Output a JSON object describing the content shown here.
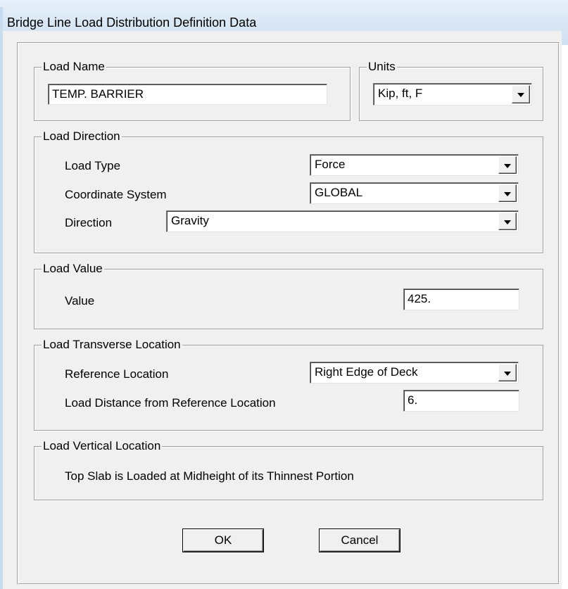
{
  "window": {
    "title": "Bridge Line Load Distribution Definition Data"
  },
  "load_name": {
    "group_label": "Load Name",
    "value": "TEMP. BARRIER"
  },
  "units": {
    "group_label": "Units",
    "selected": "Kip, ft, F"
  },
  "load_direction": {
    "group_label": "Load Direction",
    "load_type_label": "Load Type",
    "load_type_value": "Force",
    "coordinate_system_label": "Coordinate System",
    "coordinate_system_value": "GLOBAL",
    "direction_label": "Direction",
    "direction_value": "Gravity"
  },
  "load_value": {
    "group_label": "Load Value",
    "value_label": "Value",
    "value": "425."
  },
  "load_transverse_location": {
    "group_label": "Load Transverse Location",
    "reference_location_label": "Reference Location",
    "reference_location_value": "Right Edge of Deck",
    "distance_label": "Load Distance from Reference Location",
    "distance_value": "6."
  },
  "load_vertical_location": {
    "group_label": "Load Vertical Location",
    "text": "Top Slab is Loaded at Midheight of its Thinnest Portion"
  },
  "buttons": {
    "ok": "OK",
    "cancel": "Cancel"
  },
  "icons": {
    "dropdown": "chevron-down-icon"
  },
  "colors": {
    "dialog_background": "#f0f0f0",
    "titlebar": "#dbe8f5"
  }
}
